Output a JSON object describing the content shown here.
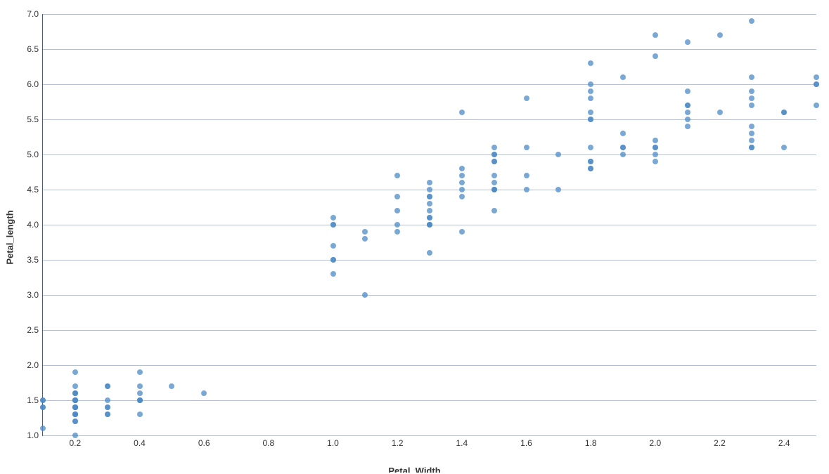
{
  "chart_data": {
    "type": "scatter",
    "title": "",
    "xlabel": "Petal_Width",
    "ylabel": "Petal_length",
    "xlim": [
      0.1,
      2.5
    ],
    "ylim": [
      1.0,
      7.0
    ],
    "x_ticks": [
      0.2,
      0.4,
      0.6,
      0.8,
      1.0,
      1.2,
      1.4,
      1.6,
      1.8,
      2.0,
      2.2,
      2.4
    ],
    "y_ticks": [
      1.0,
      1.5,
      2.0,
      2.5,
      3.0,
      3.5,
      4.0,
      4.5,
      5.0,
      5.5,
      6.0,
      6.5,
      7.0
    ],
    "color": "#4e8bc6",
    "points": [
      [
        0.1,
        1.1
      ],
      [
        0.1,
        1.4
      ],
      [
        0.1,
        1.4
      ],
      [
        0.1,
        1.5
      ],
      [
        0.1,
        1.5
      ],
      [
        0.2,
        1.0
      ],
      [
        0.2,
        1.2
      ],
      [
        0.2,
        1.2
      ],
      [
        0.2,
        1.3
      ],
      [
        0.2,
        1.3
      ],
      [
        0.2,
        1.3
      ],
      [
        0.2,
        1.3
      ],
      [
        0.2,
        1.4
      ],
      [
        0.2,
        1.4
      ],
      [
        0.2,
        1.4
      ],
      [
        0.2,
        1.4
      ],
      [
        0.2,
        1.4
      ],
      [
        0.2,
        1.4
      ],
      [
        0.2,
        1.4
      ],
      [
        0.2,
        1.4
      ],
      [
        0.2,
        1.5
      ],
      [
        0.2,
        1.5
      ],
      [
        0.2,
        1.5
      ],
      [
        0.2,
        1.5
      ],
      [
        0.2,
        1.5
      ],
      [
        0.2,
        1.5
      ],
      [
        0.2,
        1.5
      ],
      [
        0.2,
        1.5
      ],
      [
        0.2,
        1.6
      ],
      [
        0.2,
        1.6
      ],
      [
        0.2,
        1.6
      ],
      [
        0.2,
        1.7
      ],
      [
        0.2,
        1.9
      ],
      [
        0.3,
        1.3
      ],
      [
        0.3,
        1.3
      ],
      [
        0.3,
        1.4
      ],
      [
        0.3,
        1.4
      ],
      [
        0.3,
        1.5
      ],
      [
        0.3,
        1.7
      ],
      [
        0.3,
        1.7
      ],
      [
        0.4,
        1.3
      ],
      [
        0.4,
        1.5
      ],
      [
        0.4,
        1.5
      ],
      [
        0.4,
        1.5
      ],
      [
        0.4,
        1.6
      ],
      [
        0.4,
        1.7
      ],
      [
        0.4,
        1.9
      ],
      [
        0.5,
        1.7
      ],
      [
        0.6,
        1.6
      ],
      [
        1.0,
        3.3
      ],
      [
        1.0,
        3.5
      ],
      [
        1.0,
        3.5
      ],
      [
        1.0,
        3.7
      ],
      [
        1.0,
        4.0
      ],
      [
        1.0,
        4.0
      ],
      [
        1.0,
        4.1
      ],
      [
        1.1,
        3.0
      ],
      [
        1.1,
        3.8
      ],
      [
        1.1,
        3.9
      ],
      [
        1.2,
        3.9
      ],
      [
        1.2,
        4.0
      ],
      [
        1.2,
        4.2
      ],
      [
        1.2,
        4.4
      ],
      [
        1.2,
        4.7
      ],
      [
        1.3,
        3.6
      ],
      [
        1.3,
        4.0
      ],
      [
        1.3,
        4.0
      ],
      [
        1.3,
        4.0
      ],
      [
        1.3,
        4.1
      ],
      [
        1.3,
        4.1
      ],
      [
        1.3,
        4.2
      ],
      [
        1.3,
        4.3
      ],
      [
        1.3,
        4.4
      ],
      [
        1.3,
        4.4
      ],
      [
        1.3,
        4.5
      ],
      [
        1.3,
        4.6
      ],
      [
        1.4,
        3.9
      ],
      [
        1.4,
        4.4
      ],
      [
        1.4,
        4.5
      ],
      [
        1.4,
        4.6
      ],
      [
        1.4,
        4.7
      ],
      [
        1.4,
        4.8
      ],
      [
        1.4,
        5.6
      ],
      [
        1.5,
        4.2
      ],
      [
        1.5,
        4.5
      ],
      [
        1.5,
        4.5
      ],
      [
        1.5,
        4.5
      ],
      [
        1.5,
        4.6
      ],
      [
        1.5,
        4.7
      ],
      [
        1.5,
        4.9
      ],
      [
        1.5,
        4.9
      ],
      [
        1.5,
        5.0
      ],
      [
        1.5,
        5.0
      ],
      [
        1.5,
        5.1
      ],
      [
        1.6,
        4.5
      ],
      [
        1.6,
        4.7
      ],
      [
        1.6,
        5.1
      ],
      [
        1.6,
        5.8
      ],
      [
        1.7,
        4.5
      ],
      [
        1.7,
        5.0
      ],
      [
        1.8,
        4.8
      ],
      [
        1.8,
        4.8
      ],
      [
        1.8,
        4.9
      ],
      [
        1.8,
        4.9
      ],
      [
        1.8,
        5.1
      ],
      [
        1.8,
        5.5
      ],
      [
        1.8,
        5.5
      ],
      [
        1.8,
        5.6
      ],
      [
        1.8,
        5.8
      ],
      [
        1.8,
        5.9
      ],
      [
        1.8,
        6.0
      ],
      [
        1.8,
        6.3
      ],
      [
        1.9,
        5.0
      ],
      [
        1.9,
        5.1
      ],
      [
        1.9,
        5.1
      ],
      [
        1.9,
        5.3
      ],
      [
        1.9,
        6.1
      ],
      [
        2.0,
        4.9
      ],
      [
        2.0,
        5.0
      ],
      [
        2.0,
        5.1
      ],
      [
        2.0,
        5.1
      ],
      [
        2.0,
        5.2
      ],
      [
        2.0,
        6.4
      ],
      [
        2.0,
        6.7
      ],
      [
        2.1,
        5.4
      ],
      [
        2.1,
        5.5
      ],
      [
        2.1,
        5.6
      ],
      [
        2.1,
        5.7
      ],
      [
        2.1,
        5.7
      ],
      [
        2.1,
        5.9
      ],
      [
        2.1,
        6.6
      ],
      [
        2.2,
        5.6
      ],
      [
        2.2,
        6.7
      ],
      [
        2.3,
        5.1
      ],
      [
        2.3,
        5.1
      ],
      [
        2.3,
        5.2
      ],
      [
        2.3,
        5.3
      ],
      [
        2.3,
        5.4
      ],
      [
        2.3,
        5.7
      ],
      [
        2.3,
        5.8
      ],
      [
        2.3,
        5.9
      ],
      [
        2.3,
        6.1
      ],
      [
        2.3,
        6.9
      ],
      [
        2.4,
        5.1
      ],
      [
        2.4,
        5.6
      ],
      [
        2.4,
        5.6
      ],
      [
        2.5,
        5.7
      ],
      [
        2.5,
        6.0
      ],
      [
        2.5,
        6.0
      ],
      [
        2.5,
        6.1
      ]
    ]
  }
}
